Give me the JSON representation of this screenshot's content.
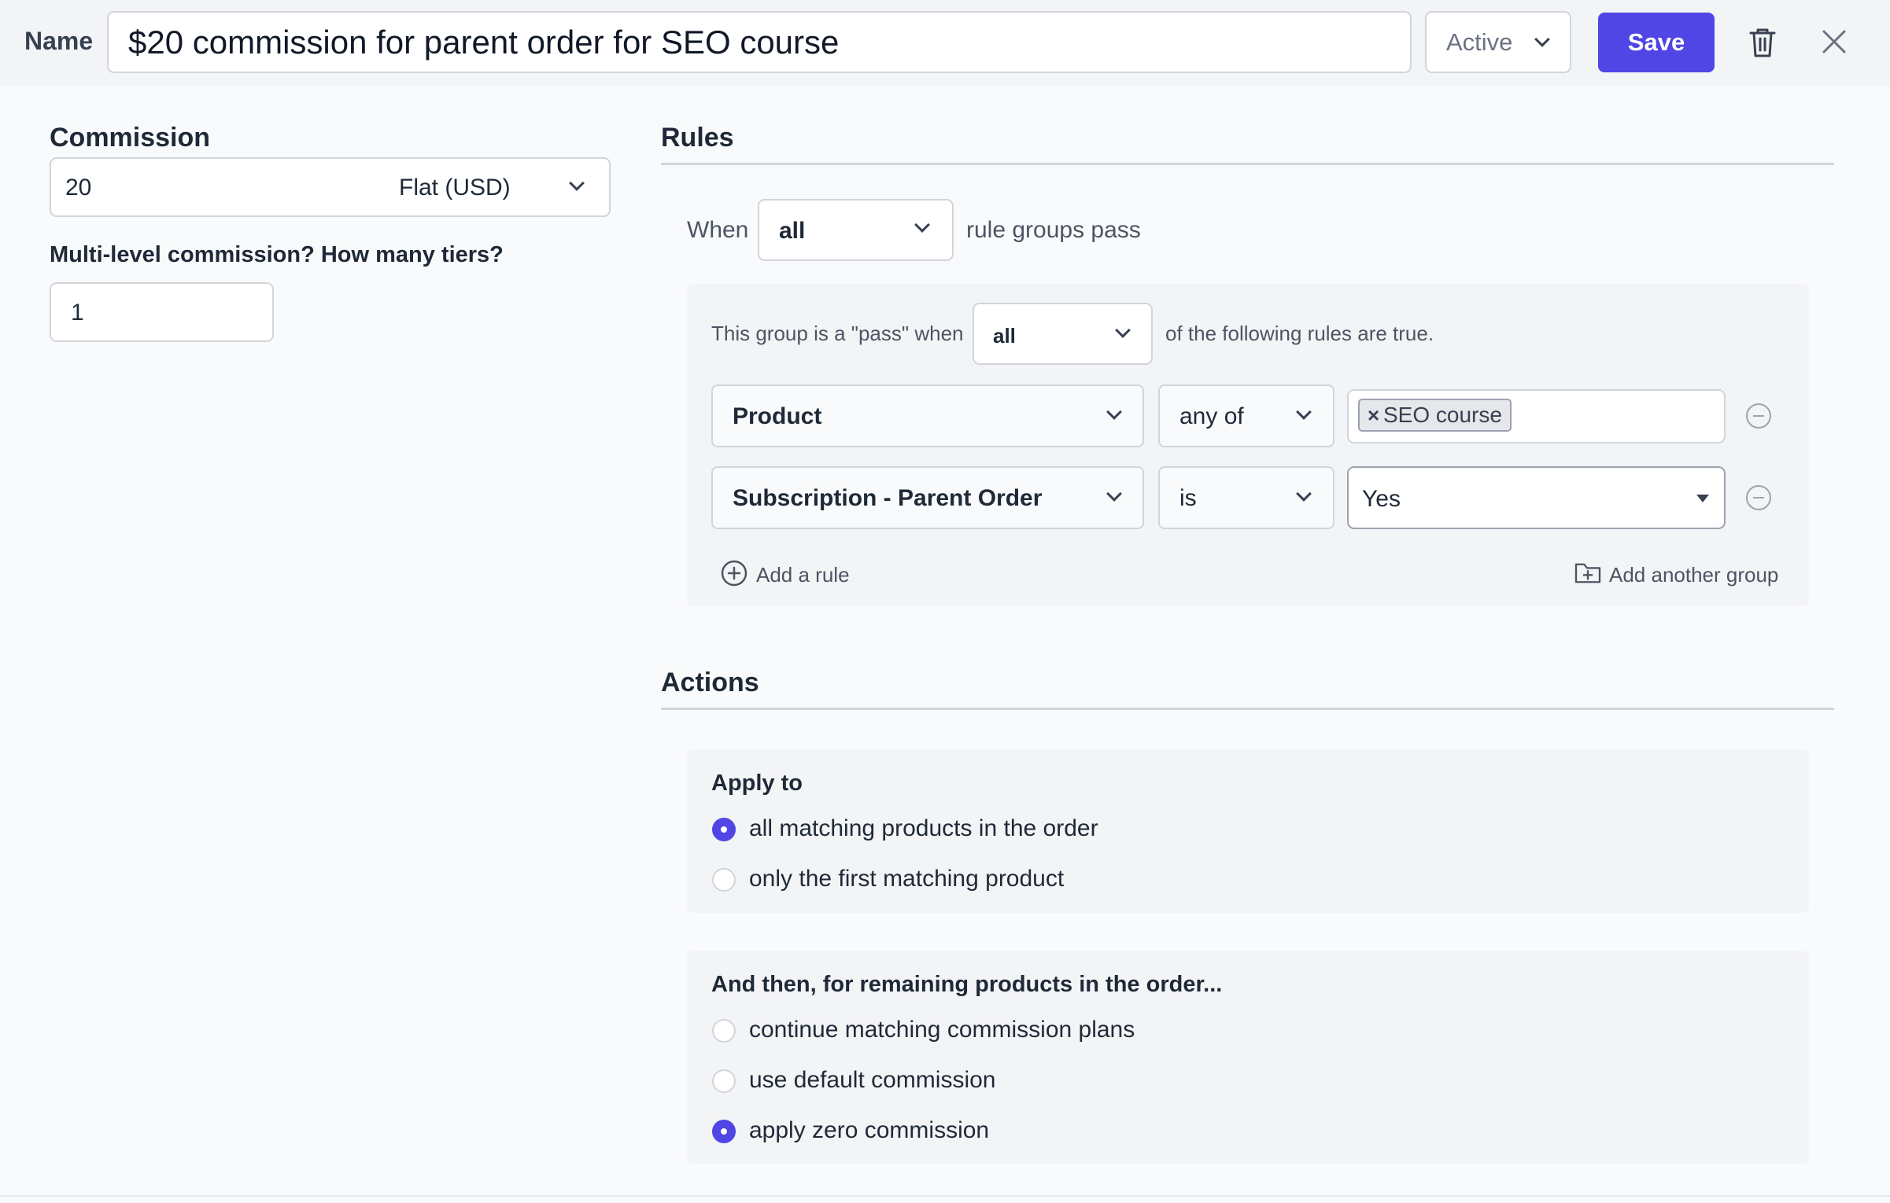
{
  "header": {
    "name_label": "Name",
    "name_value": "$20 commission for parent order for SEO course",
    "status_value": "Active",
    "save_label": "Save",
    "icons": {
      "delete": "trash-icon",
      "close": "close-icon",
      "status": "chevron-down-icon"
    }
  },
  "commission": {
    "title": "Commission",
    "amount": "20",
    "type": "Flat (USD)",
    "tiers_label": "Multi-level commission? How many tiers?",
    "tiers_value": "1"
  },
  "rules": {
    "title": "Rules",
    "when_label": "When",
    "when_value": "all",
    "when_suffix": "rule groups pass",
    "group": {
      "prefix": "This group is a \"pass\" when",
      "match_value": "all",
      "suffix": "of the following rules are true.",
      "rows": [
        {
          "field": "Product",
          "operator": "any of",
          "tags": [
            "SEO course"
          ]
        },
        {
          "field": "Subscription - Parent Order",
          "operator": "is",
          "value": "Yes"
        }
      ],
      "add_rule_label": "Add a rule",
      "add_group_label": "Add another group"
    }
  },
  "actions": {
    "title": "Actions",
    "apply_to": {
      "title": "Apply to",
      "options": [
        "all matching products in the order",
        "only the first matching product"
      ],
      "selected": 0
    },
    "remaining": {
      "title": "And then, for remaining products in the order...",
      "options": [
        "continue matching commission plans",
        "use default commission",
        "apply zero commission"
      ],
      "selected": 2
    }
  },
  "colors": {
    "accent": "#4f46e5",
    "background": "#f9fafb",
    "panel": "#f3f4f6",
    "border": "#d1d5db"
  }
}
